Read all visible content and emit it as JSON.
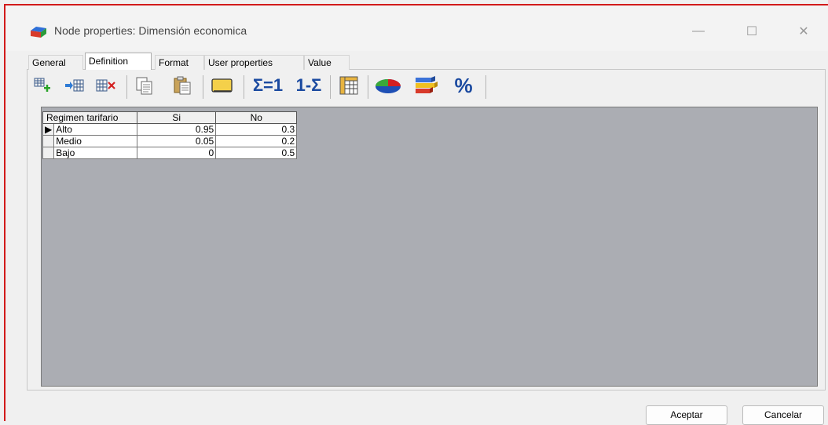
{
  "window": {
    "title": "Node properties: Dimensión economica",
    "controls": {
      "minimize": "—",
      "maximize": "☐",
      "close": "✕"
    }
  },
  "tabs": [
    {
      "label": "General"
    },
    {
      "label": "Definition",
      "active": true
    },
    {
      "label": "Format"
    },
    {
      "label": "User properties"
    },
    {
      "label": "Value"
    }
  ],
  "toolbar": {
    "icons": [
      "add-column-icon",
      "insert-column-icon",
      "delete-column-icon",
      "copy-icon",
      "paste-icon",
      "comment-icon",
      "normalize-icon",
      "complement-icon",
      "table-view-icon",
      "pie-chart-icon",
      "bar-chart-icon",
      "percent-icon"
    ],
    "normalize_label": "Σ=1",
    "complement_label": "1-Σ",
    "percent_label": "%"
  },
  "table": {
    "corner_header": "Regimen tarifario",
    "columns": [
      "Si",
      "No"
    ],
    "rows": [
      {
        "label": "Alto",
        "values": [
          "0.95",
          "0.3"
        ],
        "selected": true
      },
      {
        "label": "Medio",
        "values": [
          "0.05",
          "0.2"
        ]
      },
      {
        "label": "Bajo",
        "values": [
          "0",
          "0.5"
        ]
      }
    ]
  },
  "buttons": {
    "ok_label": "Aceptar",
    "cancel_label": "Cancelar"
  },
  "colors": {
    "window_border": "#d21a1a",
    "grid_background": "#abadb3"
  }
}
